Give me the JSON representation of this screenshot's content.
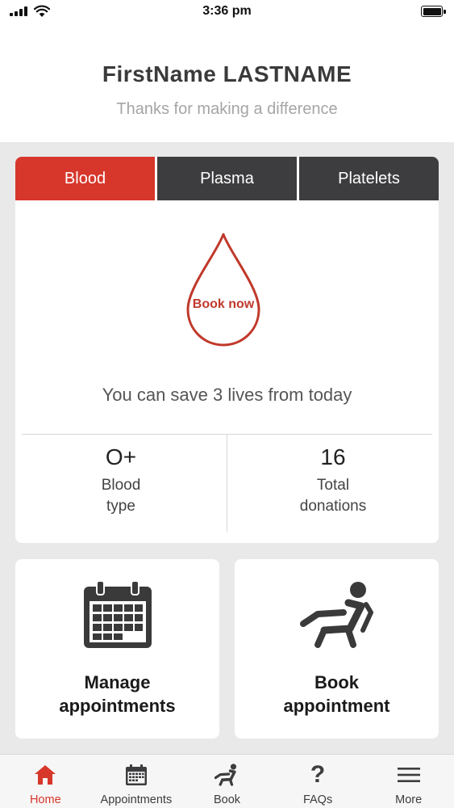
{
  "status_bar": {
    "time": "3:36 pm"
  },
  "header": {
    "user_name": "FirstName LASTNAME",
    "subtitle": "Thanks for making a difference"
  },
  "donation_card": {
    "tabs": [
      {
        "label": "Blood",
        "active": true
      },
      {
        "label": "Plasma",
        "active": false
      },
      {
        "label": "Platelets",
        "active": false
      }
    ],
    "book_now_label": "Book now",
    "lives_message": "You can save 3 lives from today",
    "stats": [
      {
        "value": "O+",
        "label": "Blood\ntype"
      },
      {
        "value": "16",
        "label": "Total\ndonations"
      }
    ]
  },
  "actions": [
    {
      "label": "Manage\nappointments",
      "icon": "calendar-icon"
    },
    {
      "label": "Book\nappointment",
      "icon": "donor-chair-icon"
    }
  ],
  "bottom_nav": [
    {
      "label": "Home",
      "icon": "home-icon",
      "active": true
    },
    {
      "label": "Appointments",
      "icon": "calendar-icon",
      "active": false
    },
    {
      "label": "Book",
      "icon": "donor-chair-icon",
      "active": false
    },
    {
      "label": "FAQs",
      "icon": "question-icon",
      "active": false
    },
    {
      "label": "More",
      "icon": "menu-icon",
      "active": false
    }
  ],
  "colors": {
    "brand_red": "#d7372b",
    "tab_dark": "#3d3c3e",
    "drop_outline": "#c0392b",
    "background": "#e9e9ea"
  }
}
